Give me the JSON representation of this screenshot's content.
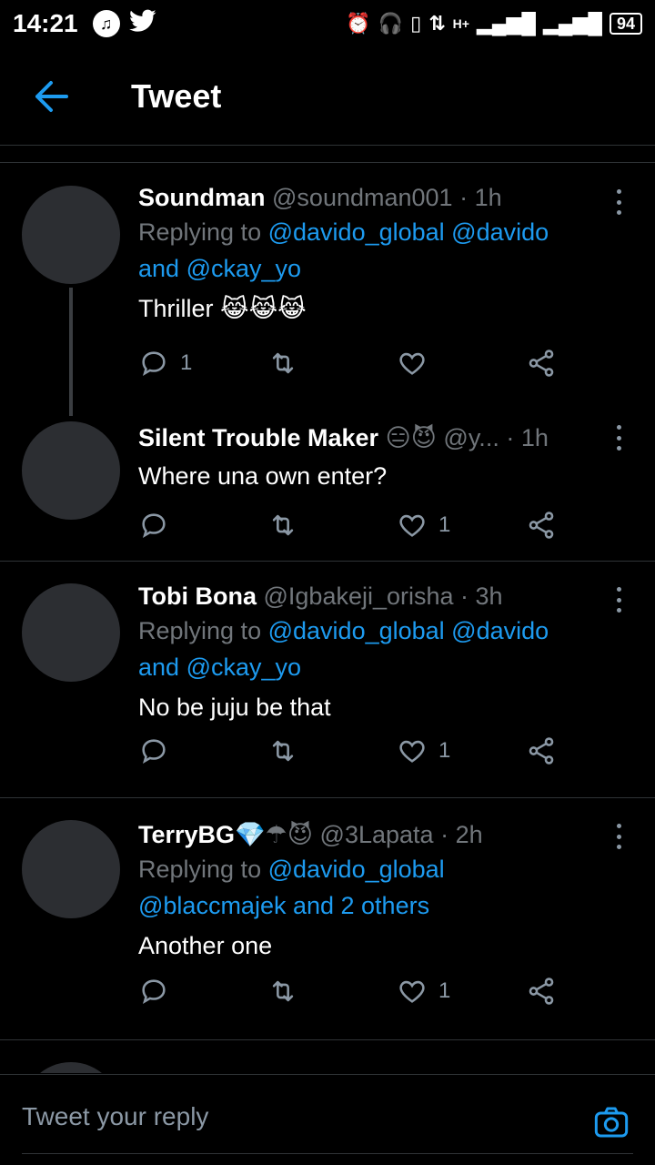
{
  "status_bar": {
    "time": "14:21",
    "left_icons": [
      "music-icon",
      "twitter-icon"
    ],
    "network": "H+",
    "battery": "94"
  },
  "header": {
    "title": "Tweet"
  },
  "tweets": [
    {
      "name": "Soundman",
      "handle": "@soundman001",
      "time": "· 1h",
      "replying_prefix": "Replying to",
      "replying_links": "@davido_global @davido",
      "replying_line2_and": "and",
      "replying_line2_link": "@ckay_yo",
      "text": "Thriller",
      "emoji": "😹😹😹",
      "reply_count": "1",
      "retweet_count": "",
      "like_count": ""
    },
    {
      "name": "Silent Trouble Maker",
      "name_emoji": "😑😈",
      "handle": "@y...",
      "time": "· 1h",
      "text": "Where una own enter?",
      "reply_count": "",
      "retweet_count": "",
      "like_count": "1"
    },
    {
      "name": "Tobi Bona",
      "handle": "@Igbakeji_orisha",
      "time": "· 3h",
      "replying_prefix": "Replying to",
      "replying_links": "@davido_global @davido",
      "replying_line2_and": "and",
      "replying_line2_link": "@ckay_yo",
      "text": "No be juju be that",
      "reply_count": "",
      "retweet_count": "",
      "like_count": "1"
    },
    {
      "name": "TerryBG",
      "name_emoji": "💎☂😈",
      "handle": "@3Lapata",
      "time": "· 2h",
      "replying_prefix": "Replying to",
      "replying_links": "@davido_global",
      "replying_line2": "@blaccmajek and 2 others",
      "text": "Another one",
      "reply_count": "",
      "retweet_count": "",
      "like_count": "1"
    }
  ],
  "reply_bar": {
    "placeholder": "Tweet your reply"
  },
  "colors": {
    "accent": "#1d9bf0",
    "background": "#000000",
    "muted": "#71767b"
  }
}
